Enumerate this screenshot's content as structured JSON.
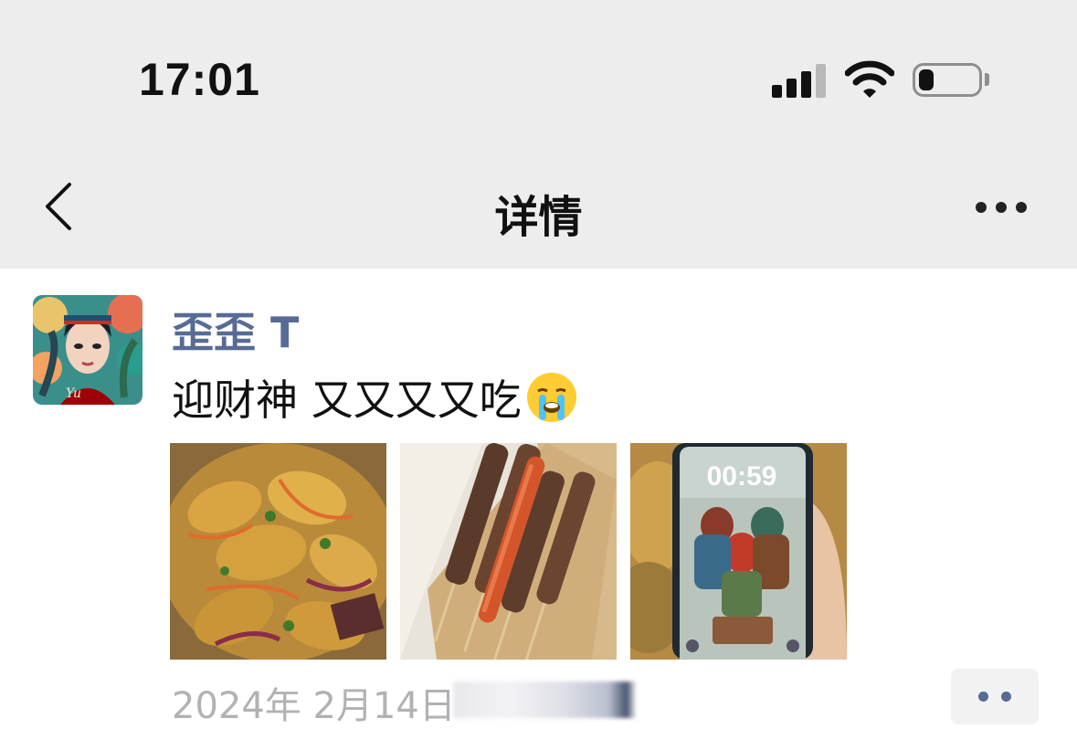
{
  "status_bar": {
    "time": "17:01",
    "signal_icon": "cellular-signal-icon",
    "wifi_icon": "wifi-icon",
    "battery_icon": "battery-icon",
    "battery_level": 0.25
  },
  "nav": {
    "back_icon": "chevron-left-icon",
    "title": "详情",
    "more_icon": "more-dots-icon"
  },
  "post": {
    "username": "歪歪 T",
    "text": "迎财神 又又又又吃",
    "emoji": "crying-face-emoji",
    "photos": [
      {
        "name": "photo-potato-dish",
        "lock_time": ""
      },
      {
        "name": "photo-skewers",
        "lock_time": ""
      },
      {
        "name": "photo-phone-lockscreen",
        "lock_time": "00:59"
      }
    ],
    "timestamp": "2024年 2月14日",
    "comment_icon": "comment-dots-icon"
  },
  "colors": {
    "nav_bg": "#ededed",
    "username": "#576b95",
    "timestamp": "#b2b2b2"
  }
}
